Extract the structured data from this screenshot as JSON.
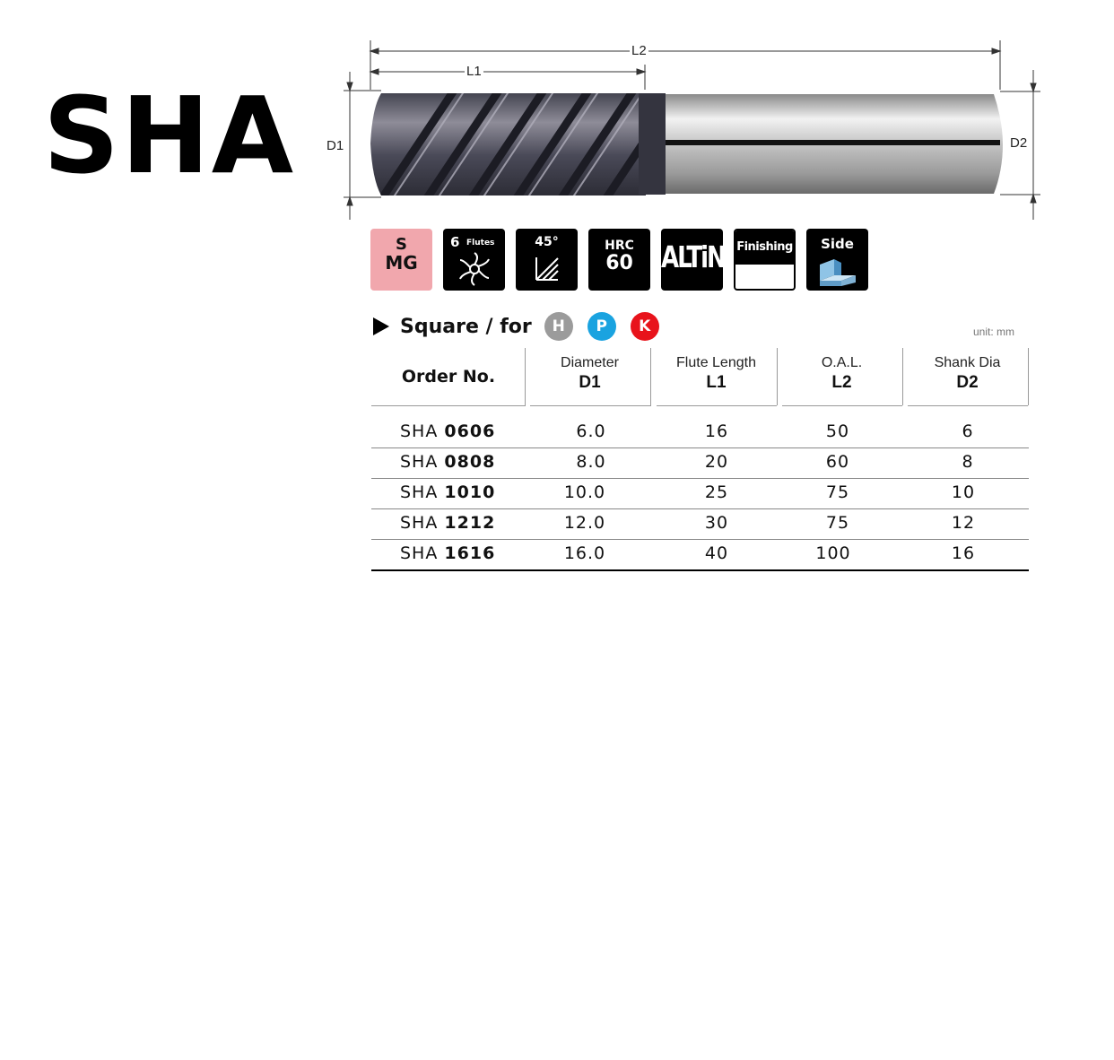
{
  "title": "SHA",
  "dimensions": {
    "l1": "L1",
    "l2": "L2",
    "d1": "D1",
    "d2": "D2"
  },
  "badges": {
    "material_top": "S",
    "material_bottom": "MG",
    "flutes_count": "6",
    "flutes_word": "Flutes",
    "helix": "45°",
    "hrc_label": "HRC",
    "hrc_value": "60",
    "coating": "ALTiN",
    "finishing": "Finishing",
    "side": "Side"
  },
  "section": {
    "title": "Square / for",
    "materials": [
      {
        "label": "H",
        "color": "#9b9b9b"
      },
      {
        "label": "P",
        "color": "#1aa3e0"
      },
      {
        "label": "K",
        "color": "#e8131b"
      }
    ],
    "unit": "unit: mm"
  },
  "table": {
    "headers": [
      {
        "name": "Order No.",
        "symbol": ""
      },
      {
        "name": "Diameter",
        "symbol": "D1"
      },
      {
        "name": "Flute Length",
        "symbol": "L1"
      },
      {
        "name": "O.A.L.",
        "symbol": "L2"
      },
      {
        "name": "Shank Dia",
        "symbol": "D2"
      }
    ],
    "rows": [
      {
        "prefix": "SHA",
        "code": "0606",
        "d1": "6.0",
        "l1": "16",
        "l2": "50",
        "d2": "6"
      },
      {
        "prefix": "SHA",
        "code": "0808",
        "d1": "8.0",
        "l1": "20",
        "l2": "60",
        "d2": "8"
      },
      {
        "prefix": "SHA",
        "code": "1010",
        "d1": "10.0",
        "l1": "25",
        "l2": "75",
        "d2": "10"
      },
      {
        "prefix": "SHA",
        "code": "1212",
        "d1": "12.0",
        "l1": "30",
        "l2": "75",
        "d2": "12"
      },
      {
        "prefix": "SHA",
        "code": "1616",
        "d1": "16.0",
        "l1": "40",
        "l2": "100",
        "d2": "16"
      }
    ]
  }
}
